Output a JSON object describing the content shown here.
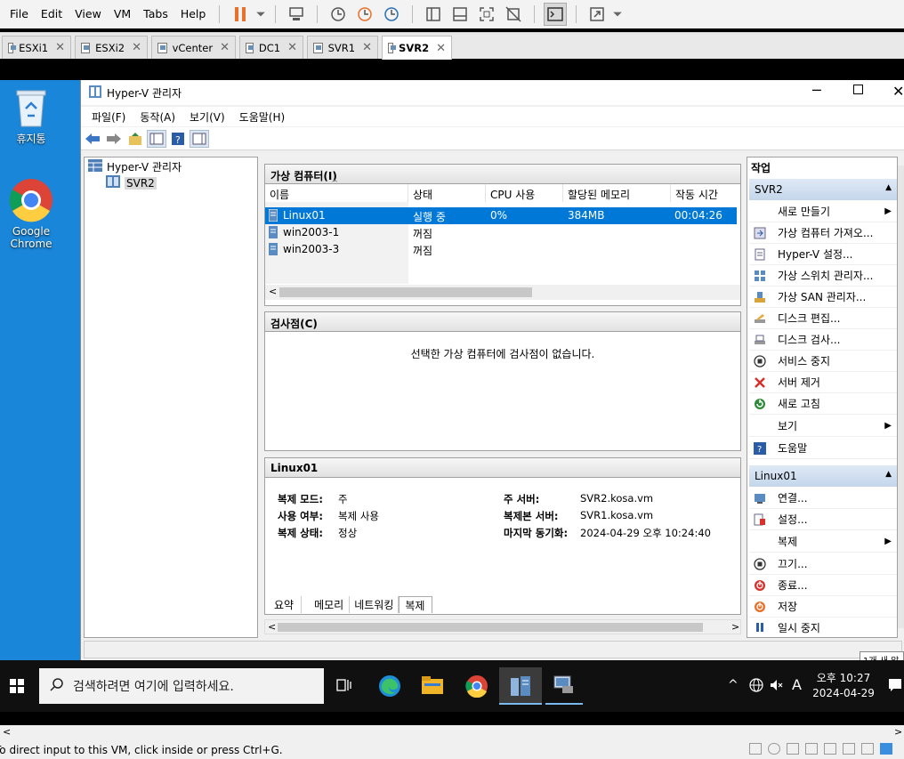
{
  "vmware": {
    "menu": [
      "File",
      "Edit",
      "View",
      "VM",
      "Tabs",
      "Help"
    ],
    "tabs": [
      {
        "label": "ESXi1"
      },
      {
        "label": "ESXi2"
      },
      {
        "label": "vCenter"
      },
      {
        "label": "DC1"
      },
      {
        "label": "SVR1"
      },
      {
        "label": "SVR2",
        "active": true
      }
    ],
    "status_text": "To direct input to this VM, click inside or press Ctrl+G."
  },
  "desktop": {
    "recycle_bin": "휴지통",
    "chrome": "Google Chrome"
  },
  "hyperv": {
    "title": "Hyper-V 관리자",
    "menu": [
      "파일(F)",
      "동작(A)",
      "보기(V)",
      "도움말(H)"
    ],
    "tree": {
      "root": "Hyper-V 관리자",
      "server": "SVR2"
    },
    "vm_panel": {
      "title": "가상 컴퓨터(I)",
      "columns": [
        "이름",
        "상태",
        "CPU 사용",
        "할당된 메모리",
        "작동 시간"
      ],
      "rows": [
        {
          "name": "Linux01",
          "state": "실행 중",
          "cpu": "0%",
          "memory": "384MB",
          "uptime": "00:04:26",
          "selected": true
        },
        {
          "name": "win2003-1",
          "state": "꺼짐",
          "cpu": "",
          "memory": "",
          "uptime": ""
        },
        {
          "name": "win2003-3",
          "state": "꺼짐",
          "cpu": "",
          "memory": "",
          "uptime": ""
        }
      ]
    },
    "checkpoint_panel": {
      "title": "검사점(C)",
      "empty_message": "선택한 가상 컴퓨터에 검사점이 없습니다."
    },
    "detail_panel": {
      "title": "Linux01",
      "left": [
        {
          "label": "복제 모드:",
          "value": "주"
        },
        {
          "label": "사용 여부:",
          "value": "복제 사용"
        },
        {
          "label": "복제 상태:",
          "value": "정상"
        }
      ],
      "right": [
        {
          "label": "주 서버:",
          "value": "SVR2.kosa.vm"
        },
        {
          "label": "복제본 서버:",
          "value": "SVR1.kosa.vm"
        },
        {
          "label": "마지막 동기화:",
          "value": "2024-04-29 오후 10:24:40"
        }
      ],
      "tabs": [
        "요약",
        "메모리",
        "네트워킹",
        "복제"
      ],
      "active_tab": "복제"
    },
    "actions": {
      "title": "작업",
      "server_section": "SVR2",
      "server_items": [
        "새로 만들기",
        "가상 컴퓨터 가져오...",
        "Hyper-V 설정...",
        "가상 스위치 관리자...",
        "가상 SAN 관리자...",
        "디스크 편집...",
        "디스크 검사...",
        "서비스 중지",
        "서버 제거",
        "새로 고침",
        "보기",
        "도움말"
      ],
      "vm_section": "Linux01",
      "vm_items": [
        "연결...",
        "설정...",
        "복제",
        "끄기...",
        "종료...",
        "저장",
        "일시 중지"
      ]
    }
  },
  "taskbar": {
    "search_placeholder": "검색하려면 여기에 입력하세요.",
    "ime": "A",
    "time": "오후 10:27",
    "date": "2024-04-29",
    "notification_tooltip": "1개 새 알"
  }
}
